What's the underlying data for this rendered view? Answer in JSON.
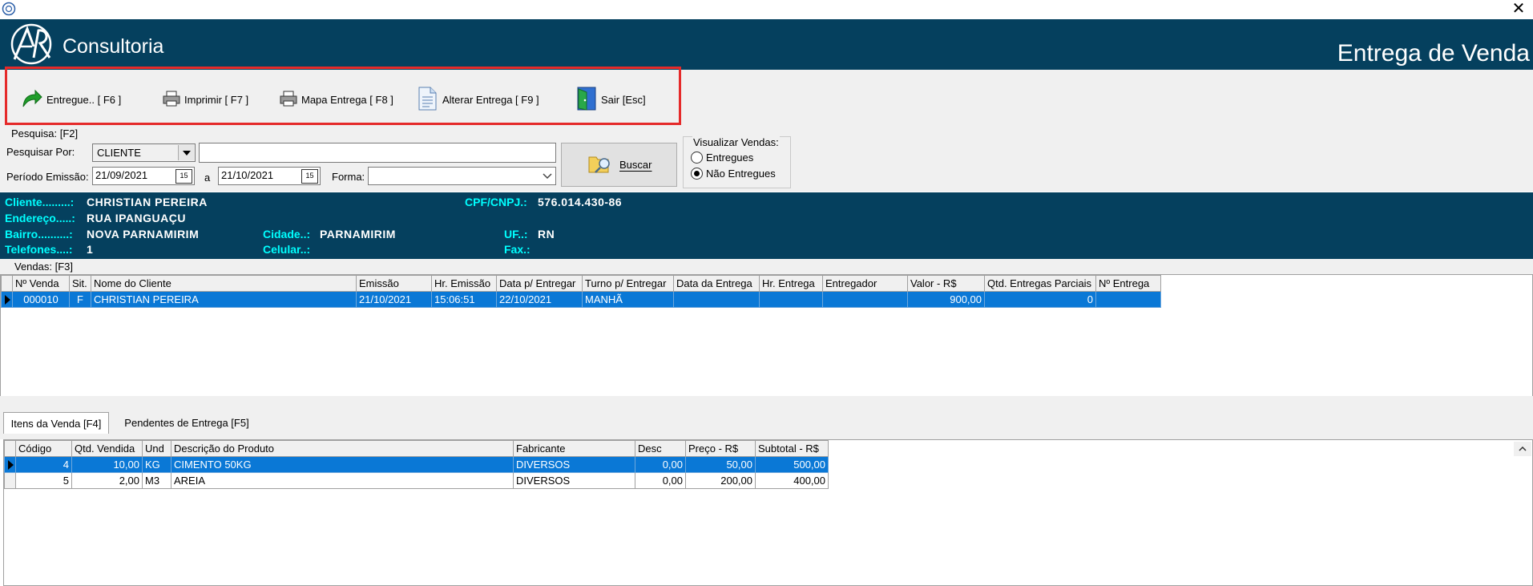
{
  "header": {
    "brand": "Consultoria",
    "title": "Entrega de Venda"
  },
  "toolbar": {
    "entregue": "Entregue.. [ F6 ]",
    "imprimir": "Imprimir  [ F7 ]",
    "mapa": "Mapa Entrega  [ F8 ]",
    "alterar": "Alterar Entrega [ F9 ]",
    "sair": "Sair [Esc]"
  },
  "search": {
    "group_label": "Pesquisa: [F2]",
    "pesquisar_por_label": "Pesquisar Por:",
    "pesquisar_por_value": "CLIENTE",
    "search_value": "",
    "periodo_label": "Período Emissão:",
    "date_from": "21/09/2021",
    "a_label": "a",
    "date_to": "21/10/2021",
    "forma_label": "Forma:",
    "forma_value": "",
    "calendar_glyph": "15",
    "buscar_label": "Buscar"
  },
  "visualizar": {
    "label": "Visualizar Vendas:",
    "entregues": "Entregues",
    "nao_entregues": "Não Entregues",
    "selected": "nao_entregues"
  },
  "cliente": {
    "cliente_label": "Cliente.........:",
    "cliente_value": "CHRISTIAN PEREIRA",
    "cpf_label": "CPF/CNPJ.:",
    "cpf_value": "576.014.430-86",
    "endereco_label": "Endereço.....:",
    "endereco_value": "RUA IPANGUAÇU",
    "bairro_label": "Bairro..........:",
    "bairro_value": "NOVA PARNAMIRIM",
    "cidade_label": "Cidade..:",
    "cidade_value": "PARNAMIRIM",
    "uf_label": "UF..:",
    "uf_value": "RN",
    "telefones_label": "Telefones....:",
    "telefones_value": "1",
    "celular_label": "Celular..:",
    "celular_value": "",
    "fax_label": "Fax.:",
    "fax_value": ""
  },
  "vendas": {
    "label": "Vendas: [F3]",
    "columns": [
      "Nº Venda",
      "Sit.",
      "Nome do Cliente",
      "Emissão",
      "Hr. Emissão",
      "Data p/ Entregar",
      "Turno p/ Entregar",
      "Data da Entrega",
      "Hr. Entrega",
      "Entregador",
      "Valor - R$",
      "Qtd. Entregas Parciais",
      "Nº Entrega"
    ],
    "rows": [
      [
        "000010",
        "F",
        "CHRISTIAN PEREIRA",
        "21/10/2021",
        "15:06:51",
        "22/10/2021",
        "MANHÃ",
        "",
        "",
        "",
        "900,00",
        "0",
        ""
      ]
    ]
  },
  "tabs": {
    "itens": "Itens da Venda [F4]",
    "pendentes": "Pendentes de Entrega [F5]"
  },
  "itens": {
    "columns": [
      "Código",
      "Qtd. Vendida",
      "Und",
      "Descrição do Produto",
      "Fabricante",
      "Desc",
      "Preço - R$",
      "Subtotal - R$"
    ],
    "rows": [
      [
        "4",
        "10,00",
        "KG",
        "CIMENTO 50KG",
        "DIVERSOS",
        "0,00",
        "50,00",
        "500,00"
      ],
      [
        "5",
        "2,00",
        "M3",
        "AREIA",
        "DIVERSOS",
        "0,00",
        "200,00",
        "400,00"
      ]
    ]
  }
}
